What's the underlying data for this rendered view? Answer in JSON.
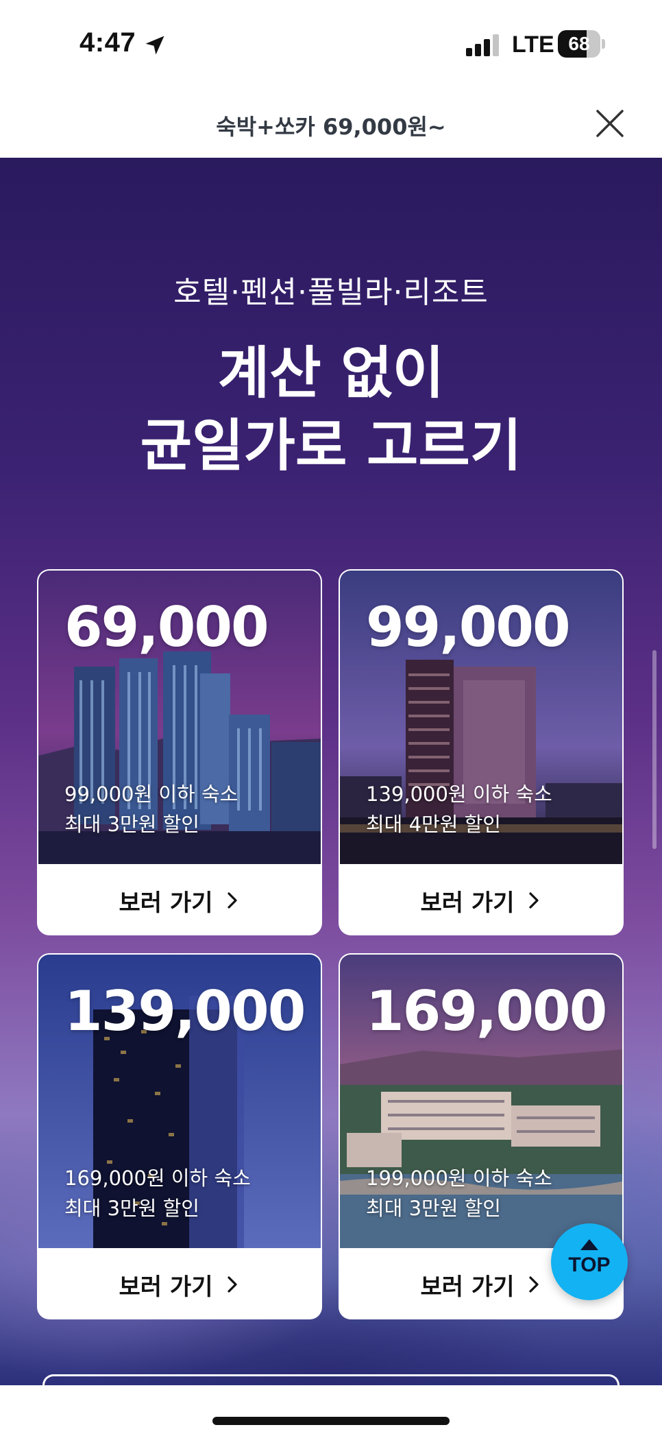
{
  "status_bar": {
    "time": "4:47",
    "network": "LTE",
    "battery": "68",
    "battery_level": 0.68
  },
  "header": {
    "title": "숙박+쏘카 69,000원~"
  },
  "promo": {
    "subtitle": "호텔·펜션·풀빌라·리조트",
    "headline_line1": "계산 없이",
    "headline_line2": "균일가로 고르기"
  },
  "cards": [
    {
      "price": "69,000",
      "desc_line1": "99,000원 이하 숙소",
      "desc_line2": "최대 3만원 할인",
      "button": "보러 가기"
    },
    {
      "price": "99,000",
      "desc_line1": "139,000원 이하 숙소",
      "desc_line2": "최대 4만원 할인",
      "button": "보러 가기"
    },
    {
      "price": "139,000",
      "desc_line1": "169,000원 이하 숙소",
      "desc_line2": "최대 3만원 할인",
      "button": "보러 가기"
    },
    {
      "price": "169,000",
      "desc_line1": "199,000원 이하 숙소",
      "desc_line2": "최대 3만원 할인",
      "button": "보러 가기"
    }
  ],
  "top_button": {
    "label": "TOP"
  },
  "icons": {
    "location": "location-arrow-icon",
    "signal": "cellular-signal-icon",
    "battery": "battery-icon",
    "close": "close-icon",
    "chevron": "chevron-right-icon",
    "top_arrow": "arrow-up-icon"
  },
  "colors": {
    "top_button": "#13b2f2",
    "header_text": "#333a44",
    "promo_bg_top": "#2a1a5e",
    "promo_bg_mid": "#7d4c9f"
  }
}
